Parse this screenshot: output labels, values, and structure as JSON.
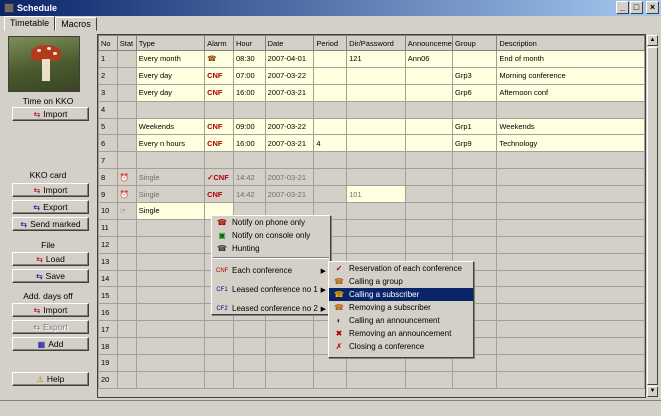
{
  "window": {
    "title": "Schedule",
    "btn_min": "_",
    "btn_max": "□",
    "btn_close": "×"
  },
  "tabs": [
    {
      "label": "Timetable"
    },
    {
      "label": "Macros"
    }
  ],
  "left": {
    "time_label": "Time on KKO",
    "import1": "Import",
    "kko_card": "KKO card",
    "import2": "Import",
    "export1": "Export",
    "send_marked": "Send marked",
    "file_label": "File",
    "load": "Load",
    "save": "Save",
    "days_off_label": "Add. days off",
    "import3": "Import",
    "export2": "Export",
    "add": "Add",
    "help": "Help"
  },
  "table": {
    "headers": [
      "No",
      "Stat",
      "Type",
      "Alarm",
      "Hour",
      "Date",
      "Period",
      "Dir/Password",
      "Announceme",
      "Group",
      "Description"
    ],
    "rows": [
      {
        "no": "1",
        "stat": "",
        "type": "Every month",
        "alarm": "phone",
        "hour": "08:30",
        "date": "2007-04-01",
        "period": "",
        "dir": "121",
        "ann": "Ann06",
        "group": "",
        "desc": "End of month",
        "style": "y"
      },
      {
        "no": "2",
        "stat": "",
        "type": "Every day",
        "alarm": "CNF",
        "hour": "07:00",
        "date": "2007-03-22",
        "period": "",
        "dir": "",
        "ann": "",
        "group": "Grp3",
        "desc": "Morning conference",
        "style": "y"
      },
      {
        "no": "3",
        "stat": "",
        "type": "Every day",
        "alarm": "CNF",
        "hour": "16:00",
        "date": "2007-03-21",
        "period": "",
        "dir": "",
        "ann": "",
        "group": "Grp6",
        "desc": "Afternoon conf",
        "style": "y"
      },
      {
        "no": "4",
        "stat": "",
        "type": "",
        "alarm": "",
        "hour": "",
        "date": "",
        "period": "",
        "dir": "",
        "ann": "",
        "group": "",
        "desc": "",
        "style": ""
      },
      {
        "no": "5",
        "stat": "",
        "type": "Weekends",
        "alarm": "CNF",
        "hour": "09:00",
        "date": "2007-03-22",
        "period": "",
        "dir": "",
        "ann": "",
        "group": "Grp1",
        "desc": "Weekends",
        "style": "y"
      },
      {
        "no": "6",
        "stat": "",
        "type": "Every n hours",
        "alarm": "CNF",
        "hour": "16:00",
        "date": "2007-03-21",
        "period": "4",
        "dir": "",
        "ann": "",
        "group": "Grp9",
        "desc": "Technology",
        "style": "y"
      },
      {
        "no": "7",
        "stat": "",
        "type": "",
        "alarm": "",
        "hour": "",
        "date": "",
        "period": "",
        "dir": "",
        "ann": "",
        "group": "",
        "desc": "",
        "style": ""
      },
      {
        "no": "8",
        "stat": "clock",
        "type": "Single",
        "alarm": "checkCNF",
        "hour": "14:42",
        "date": "2007-03-21",
        "period": "",
        "dir": "",
        "ann": "",
        "group": "",
        "desc": "",
        "style": "g"
      },
      {
        "no": "9",
        "stat": "clock",
        "type": "Single",
        "alarm": "CNF",
        "hour": "14:42",
        "date": "2007-03-21",
        "period": "",
        "dir": "101",
        "ann": "",
        "group": "",
        "desc": "",
        "style": "g"
      },
      {
        "no": "10",
        "stat": "hand",
        "type": "Single",
        "alarm": "",
        "hour": "",
        "date": "",
        "period": "",
        "dir": "",
        "ann": "",
        "group": "",
        "desc": "",
        "style": "y10"
      },
      {
        "no": "11"
      },
      {
        "no": "12"
      },
      {
        "no": "13"
      },
      {
        "no": "14"
      },
      {
        "no": "15"
      },
      {
        "no": "16"
      },
      {
        "no": "17"
      },
      {
        "no": "18"
      },
      {
        "no": "19"
      },
      {
        "no": "20"
      }
    ]
  },
  "context_menu": {
    "items": [
      {
        "label": "Notify on phone only",
        "icon": "phone-icon"
      },
      {
        "label": "Notify on console only",
        "icon": "console-icon"
      },
      {
        "label": "Hunting",
        "icon": "hunting-icon"
      }
    ],
    "sub_items": [
      {
        "label": "Each conference",
        "icon": "cnf-icon"
      },
      {
        "label": "Leased conference no 1",
        "icon": "cf1-icon"
      },
      {
        "label": "Leased conference no 2",
        "icon": "cf2-icon"
      }
    ]
  },
  "sub_menu": {
    "items": [
      {
        "label": "Reservation of each conference",
        "icon": "check-icon"
      },
      {
        "label": "Calling a group",
        "icon": "group-call-icon"
      },
      {
        "label": "Calling a subscriber",
        "icon": "subscriber-call-icon"
      },
      {
        "label": "Removing a subscriber",
        "icon": "remove-subscriber-icon"
      },
      {
        "label": "Calling an announcement",
        "icon": "announcement-icon"
      },
      {
        "label": "Removing an announcement",
        "icon": "remove-announcement-icon"
      },
      {
        "label": "Closing a conference",
        "icon": "close-conference-icon"
      }
    ]
  },
  "glyphs": {
    "cnf": "CNF",
    "cf1": "CF1",
    "cf2": "CF2",
    "check_cnf": "✓CNF",
    "phone": "☎",
    "clock": "⏰",
    "hand": "☞"
  }
}
